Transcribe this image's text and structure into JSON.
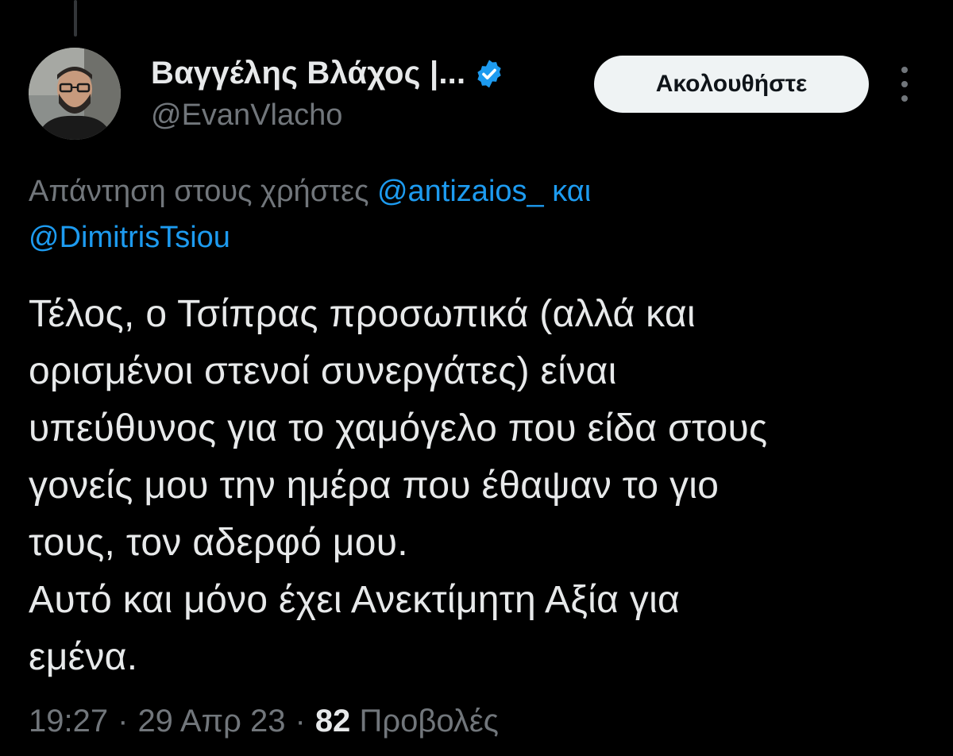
{
  "author": {
    "display_name": "Βαγγέλης Βλάχος |...",
    "handle": "@EvanVlacho",
    "verified_icon": "verified-badge-icon",
    "avatar_icon": "profile-avatar"
  },
  "actions": {
    "follow_label": "Ακολουθήστε",
    "more_icon": "more-vertical-icon"
  },
  "reply_context": {
    "prefix": "Απάντηση στους χρήστες ",
    "mention_1": "@antizaios_",
    "connector": " και",
    "mention_2": "@DimitrisTsiou"
  },
  "tweet": {
    "lines": [
      "Τέλος, ο Τσίπρας προσωπικά (αλλά και",
      "ορισμένοι στενοί συνεργάτες) είναι",
      "υπεύθυνος για το χαμόγελο που είδα στους",
      "γονείς μου την ημέρα που έθαψαν το γιο",
      "τους, τον αδερφό μου.",
      "Αυτό και μόνο έχει Ανεκτίμητη Αξία για",
      "εμένα."
    ]
  },
  "meta": {
    "time": "19:27",
    "separator": "·",
    "date": "29 Απρ 23",
    "views_count": "82",
    "views_label": "Προβολές"
  },
  "colors": {
    "background": "#000000",
    "text_primary": "#e7e9ea",
    "text_secondary": "#71767b",
    "accent_link": "#1d9bf0",
    "button_bg": "#eff3f4",
    "button_text": "#0f1419"
  }
}
